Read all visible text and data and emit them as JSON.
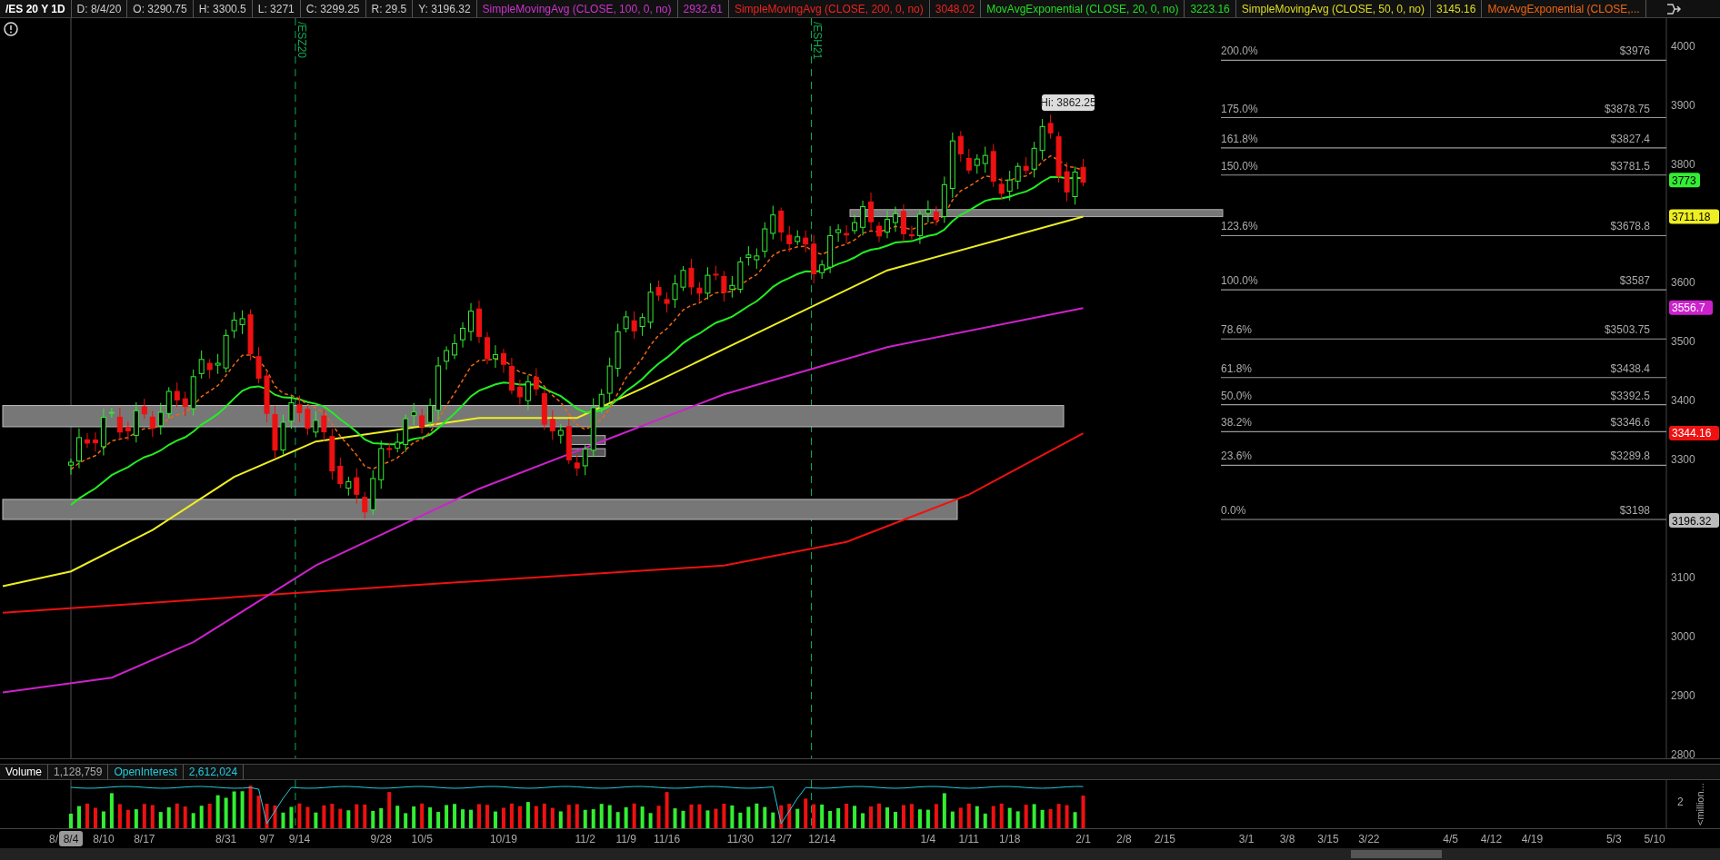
{
  "header": {
    "symbol": "/ES 20 Y 1D",
    "fields": [
      "D: 8/4/20",
      "O: 3290.75",
      "H: 3300.5",
      "L: 3271",
      "C: 3299.25",
      "R: 29.5",
      "Y: 3196.32"
    ]
  },
  "studies": [
    {
      "label": "SimpleMovingAvg (CLOSE, 100, 0, no)",
      "value": "2932.61",
      "color": "#cc33cc"
    },
    {
      "label": "SimpleMovingAvg (CLOSE, 200, 0, no)",
      "value": "3048.02",
      "color": "#ee2222"
    },
    {
      "label": "MovAvgExponential (CLOSE, 20, 0, no)",
      "value": "3223.16",
      "color": "#22dd22"
    },
    {
      "label": "SimpleMovingAvg (CLOSE, 50, 0, no)",
      "value": "3145.16",
      "color": "#dddd22"
    },
    {
      "label": "MovAvgExponential (CLOSE,...",
      "color": "#ee6611"
    }
  ],
  "price_chart": {
    "contract_markers": [
      "/ESZ20",
      "/ESH21"
    ],
    "high_label": "Hi: 3862.25",
    "fib_levels": [
      {
        "percent": "200.0%",
        "price": "$3976"
      },
      {
        "percent": "175.0%",
        "price": "$3878.75"
      },
      {
        "percent": "161.8%",
        "price": "$3827.4"
      },
      {
        "percent": "150.0%",
        "price": "$3781.5"
      },
      {
        "percent": "123.6%",
        "price": "$3678.8"
      },
      {
        "percent": "100.0%",
        "price": "$3587"
      },
      {
        "percent": "78.6%",
        "price": "$3503.75"
      },
      {
        "percent": "61.8%",
        "price": "$3438.4"
      },
      {
        "percent": "50.0%",
        "price": "$3392.5"
      },
      {
        "percent": "38.2%",
        "price": "$3346.6"
      },
      {
        "percent": "23.6%",
        "price": "$3289.8"
      },
      {
        "percent": "0.0%",
        "price": "$3198"
      }
    ],
    "price_axis": [
      "4000",
      "3900",
      "3800",
      "3600",
      "3500",
      "3400",
      "3300",
      "3100",
      "3000",
      "2900",
      "2800"
    ],
    "price_badges": [
      {
        "text": "3773",
        "color": "#33ee33"
      },
      {
        "text": "3711.18",
        "color": "#eeee22"
      },
      {
        "text": "3556.7",
        "color": "#cc22cc"
      },
      {
        "text": "3344.16",
        "color": "#ee1111"
      },
      {
        "text": "3196.32",
        "color": "#bbbbbb"
      }
    ]
  },
  "volume": {
    "title": "Volume",
    "value": "1,128,759",
    "oi_label": "OpenInterest",
    "oi_value": "2,612,024",
    "axis": [
      "2"
    ],
    "unit": "<million..."
  },
  "x_axis": {
    "cursor": "8/4",
    "labels": [
      "8/",
      "8/10",
      "8/17",
      "8/31",
      "9/7",
      "9/14",
      "9/28",
      "10/5",
      "10/19",
      "11/2",
      "11/9",
      "11/16",
      "11/30",
      "12/7",
      "12/14",
      "1/4",
      "1/11",
      "1/18",
      "2/1",
      "2/8",
      "2/15",
      "3/1",
      "3/8",
      "3/15",
      "3/22",
      "4/5",
      "4/12",
      "4/19",
      "5/3",
      "5/10"
    ]
  }
}
